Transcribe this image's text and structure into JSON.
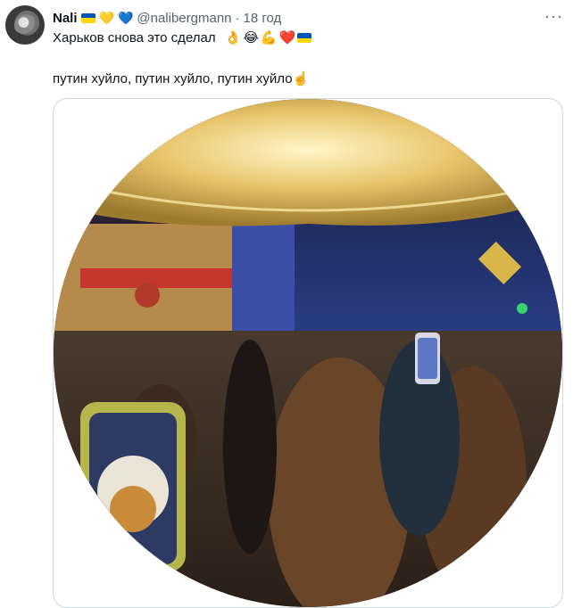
{
  "tweet": {
    "author_name": "Nali",
    "author_handle": "@nalibergmann",
    "separator": "·",
    "time": "18 год",
    "text_line1": "Харьков снова это сделал",
    "text_line2": "путин хуйло, путин хуйло, путин хуйло",
    "emojis_line1": [
      "👌",
      "😂",
      "💪",
      "❤️"
    ],
    "emoji_line2": "☝️",
    "hearts": [
      "💛",
      "💙"
    ],
    "more_icon": "···",
    "colors": {
      "text": "#0f1419",
      "muted": "#536471",
      "ukraine_blue": "#0057b7",
      "ukraine_yellow": "#ffd700",
      "border": "#cfd9de"
    }
  }
}
